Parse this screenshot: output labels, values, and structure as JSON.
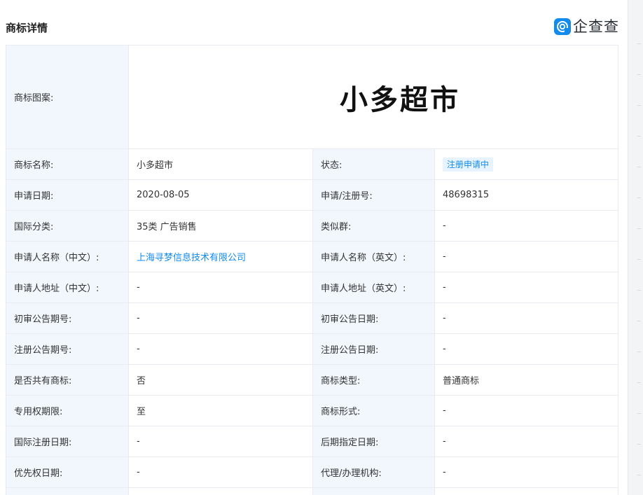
{
  "header": {
    "title": "商标详情",
    "brand_name": "企查查",
    "brand_color": "#128bed"
  },
  "trademark": {
    "image_label": "商标图案:",
    "image_text": "小多超市"
  },
  "rows": [
    {
      "l1": "商标名称:",
      "v1": "小多超市",
      "l2": "状态:",
      "v2": "注册申请中"
    },
    {
      "l1": "申请日期:",
      "v1": "2020-08-05",
      "l2": "申请/注册号:",
      "v2": "48698315"
    },
    {
      "l1": "国际分类:",
      "v1": "35类 广告销售",
      "l2": "类似群:",
      "v2": "-"
    },
    {
      "l1": "申请人名称（中文）:",
      "v1": "上海寻梦信息技术有限公司",
      "l2": "申请人名称（英文）:",
      "v2": "-"
    },
    {
      "l1": "申请人地址（中文）:",
      "v1": "-",
      "l2": "申请人地址（英文）:",
      "v2": "-"
    },
    {
      "l1": "初审公告期号:",
      "v1": "-",
      "l2": "初审公告日期:",
      "v2": "-"
    },
    {
      "l1": "注册公告期号:",
      "v1": "-",
      "l2": "注册公告日期:",
      "v2": "-"
    },
    {
      "l1": "是否共有商标:",
      "v1": "否",
      "l2": "商标类型:",
      "v2": "普通商标"
    },
    {
      "l1": "专用权期限:",
      "v1": "至",
      "l2": "商标形式:",
      "v2": "-"
    },
    {
      "l1": "国际注册日期:",
      "v1": "-",
      "l2": "后期指定日期:",
      "v2": "-"
    },
    {
      "l1": "优先权日期:",
      "v1": "-",
      "l2": "代理/办理机构:",
      "v2": "-"
    }
  ]
}
